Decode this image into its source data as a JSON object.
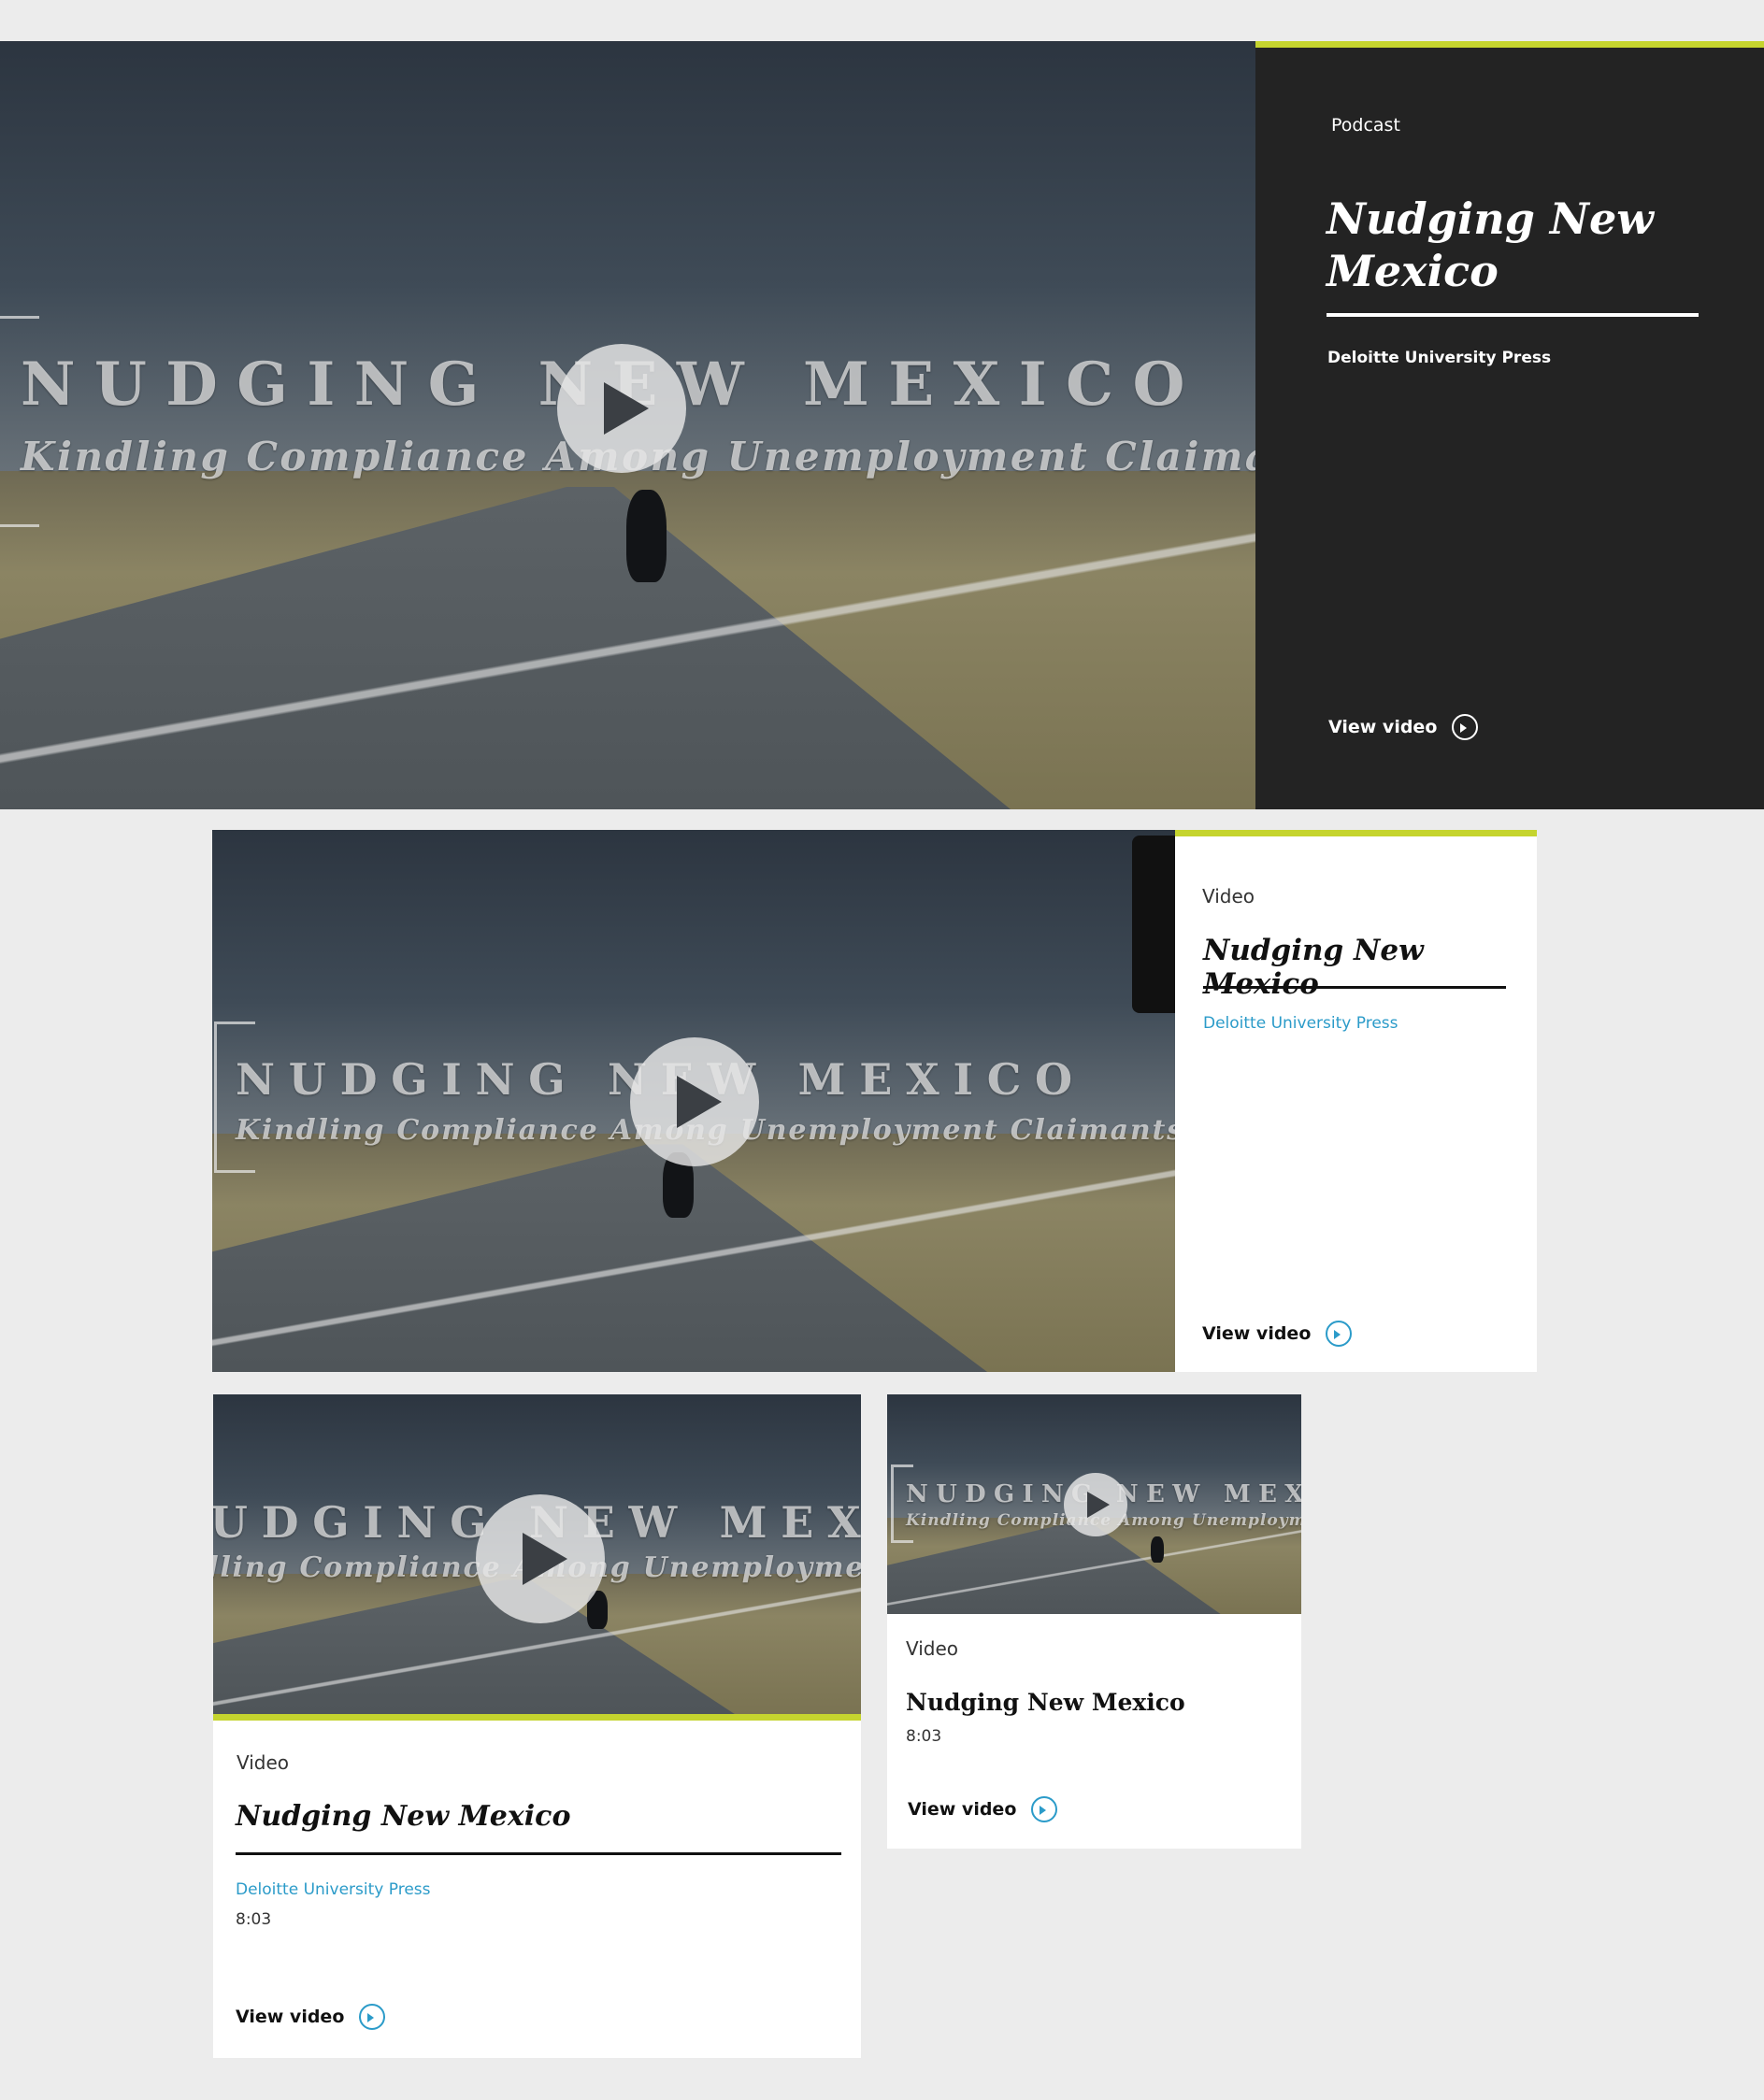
{
  "colors": {
    "accent_bar": "#c5d42e",
    "dark_panel": "#232323",
    "link_blue": "#2b9bc9",
    "page_bg": "#ececec"
  },
  "video_overlay": {
    "title": "NUDGING NEW MEXICO",
    "subtitle": "Kindling Compliance Among Unemployment Claimants"
  },
  "hero_card": {
    "type_label": "Podcast",
    "title": "Nudging New Mexico",
    "source": "Deloitte University Press",
    "action_label": "View video",
    "action_icon": "arrow-right-circle-icon",
    "play_icon": "play-icon"
  },
  "wide_card": {
    "type_label": "Video",
    "title": "Nudging New Mexico",
    "source": "Deloitte University Press",
    "action_label": "View video",
    "action_icon": "arrow-right-circle-icon",
    "play_icon": "play-icon"
  },
  "medium_card": {
    "type_label": "Video",
    "title": "Nudging New Mexico",
    "source": "Deloitte University Press",
    "duration": "8:03",
    "action_label": "View video",
    "action_icon": "arrow-right-circle-icon",
    "play_icon": "play-icon"
  },
  "small_card": {
    "type_label": "Video",
    "title": "Nudging New Mexico",
    "duration": "8:03",
    "action_label": "View video",
    "action_icon": "arrow-right-circle-icon",
    "play_icon": "play-icon"
  }
}
